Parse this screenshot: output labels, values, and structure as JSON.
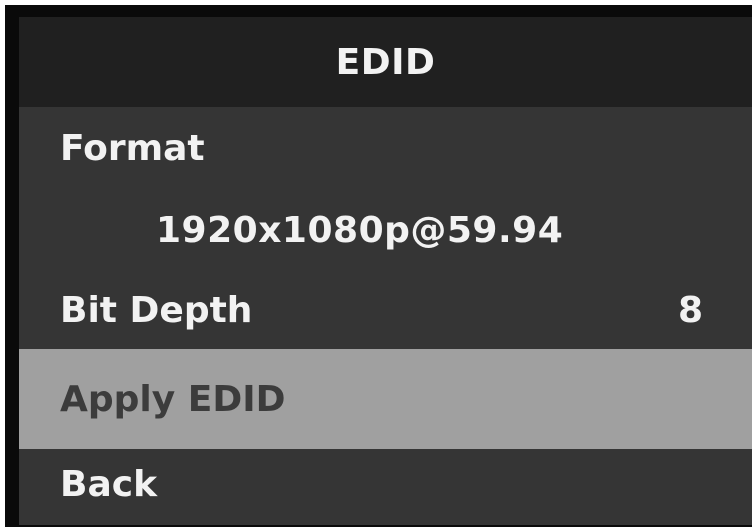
{
  "menu": {
    "title": "EDID",
    "format": {
      "label": "Format",
      "value": "1920x1080p@59.94"
    },
    "bit_depth": {
      "label": "Bit Depth",
      "value": "8"
    },
    "apply": {
      "label": "Apply EDID",
      "selected": true
    },
    "back": {
      "label": "Back"
    }
  },
  "colors": {
    "title_bar": "#202020",
    "panel": "#353535",
    "selected_row": "#a0a0a0",
    "text": "#f2f2f2",
    "selected_text": "#3c3c3c"
  }
}
